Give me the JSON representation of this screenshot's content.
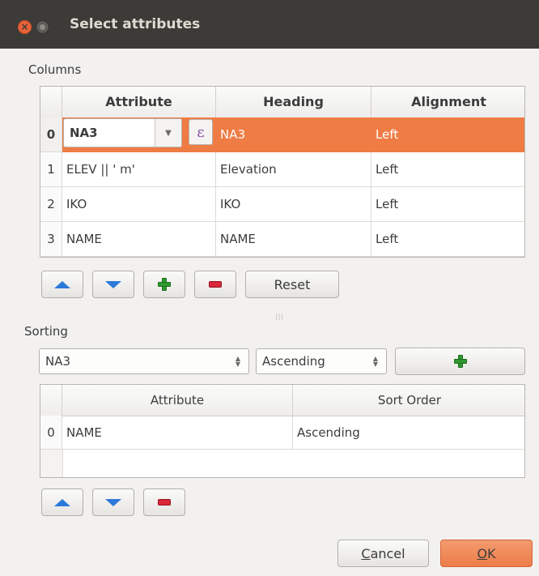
{
  "window": {
    "title": "Select attributes",
    "close_glyph": "×"
  },
  "columns": {
    "label": "Columns",
    "headers": [
      "Attribute",
      "Heading",
      "Alignment"
    ],
    "rows": [
      {
        "index": "0",
        "attribute": "NA3",
        "heading": "NA3",
        "alignment": "Left"
      },
      {
        "index": "1",
        "attribute": "ELEV || ' m'",
        "heading": "Elevation",
        "alignment": "Left"
      },
      {
        "index": "2",
        "attribute": "IKO",
        "heading": "IKO",
        "alignment": "Left"
      },
      {
        "index": "3",
        "attribute": "NAME",
        "heading": "NAME",
        "alignment": "Left"
      }
    ],
    "selected_row": 0,
    "expression_glyph": "ε",
    "reset_label": "Reset"
  },
  "sorting": {
    "label": "Sorting",
    "field_value": "NA3",
    "order_value": "Ascending",
    "headers": [
      "Attribute",
      "Sort Order"
    ],
    "rows": [
      {
        "index": "0",
        "attribute": "NAME",
        "sort_order": "Ascending"
      }
    ]
  },
  "footer": {
    "cancel_label": "Cancel",
    "cancel_mnemonic": "C",
    "cancel_rest": "ancel",
    "ok_label": "OK",
    "ok_mnemonic": "O",
    "ok_rest": "K"
  },
  "colors": {
    "titlebar": "#3c3b37",
    "close_button": "#e9633a",
    "selection": "#ef7c44",
    "ok_button": "#ec7d47",
    "arrow_icon": "#2b79d8",
    "add_icon": "#2f9a2f",
    "remove_icon": "#d8283a"
  },
  "icons": [
    "close-icon",
    "minimize-icon",
    "move-up-icon",
    "move-down-icon",
    "add-icon",
    "remove-icon",
    "expression-icon",
    "dropdown-arrow-icon",
    "spin-arrows-icon"
  ]
}
